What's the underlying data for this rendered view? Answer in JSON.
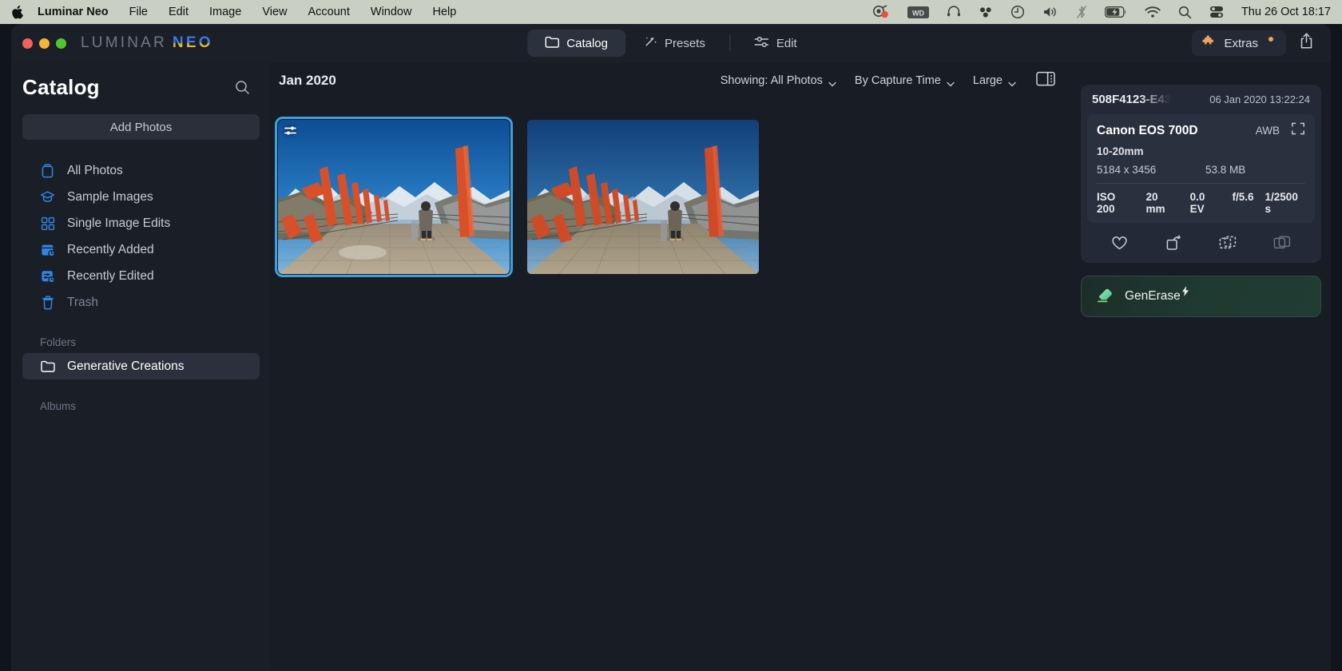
{
  "menubar": {
    "apple_icon": "apple-icon",
    "items": [
      {
        "label": "Luminar Neo",
        "bold": true
      },
      {
        "label": "File"
      },
      {
        "label": "Edit"
      },
      {
        "label": "Image"
      },
      {
        "label": "View"
      },
      {
        "label": "Account"
      },
      {
        "label": "Window"
      },
      {
        "label": "Help"
      }
    ],
    "tray_icons": [
      "screen-recording-icon",
      "wd-drive-icon",
      "headphones-icon",
      "dropbox-icon",
      "time-machine-icon",
      "volume-icon",
      "bluetooth-off-icon",
      "battery-charging-icon",
      "wifi-icon",
      "spotlight-search-icon",
      "control-center-icon"
    ],
    "clock": "Thu 26 Oct  18:17"
  },
  "app": {
    "brand_primary": "LUMINAR",
    "brand_secondary": "NEO",
    "traffic_lights": [
      "close",
      "minimize",
      "zoom"
    ],
    "tabs": [
      {
        "label": "Catalog",
        "icon": "folder-icon",
        "active": true
      },
      {
        "label": "Presets",
        "icon": "magic-wand-icon",
        "active": false
      },
      {
        "label": "Edit",
        "icon": "sliders-icon",
        "active": false
      }
    ],
    "extras_label": "Extras",
    "extras_icon": "puzzle-piece-icon",
    "extras_has_notification": true,
    "share_icon": "share-icon",
    "accent_orange": "#f0a261",
    "accent_blue": "#3e9fe0"
  },
  "sidebar": {
    "title": "Catalog",
    "search_icon": "search-icon",
    "add_photos_label": "Add Photos",
    "items": [
      {
        "label": "All Photos",
        "icon": "all-photos-icon",
        "state": "normal"
      },
      {
        "label": "Sample Images",
        "icon": "graduation-cap-icon",
        "state": "normal"
      },
      {
        "label": "Single Image Edits",
        "icon": "grid-squares-icon",
        "state": "normal"
      },
      {
        "label": "Recently Added",
        "icon": "calendar-clock-icon",
        "state": "normal"
      },
      {
        "label": "Recently Edited",
        "icon": "sliders-clock-icon",
        "state": "normal"
      },
      {
        "label": "Trash",
        "icon": "trash-icon",
        "state": "dim"
      }
    ],
    "sections": [
      {
        "label": "Folders",
        "items": [
          {
            "label": "Generative Creations",
            "icon": "folder-icon",
            "selected": true
          }
        ]
      },
      {
        "label": "Albums",
        "items": []
      }
    ]
  },
  "content": {
    "month_title": "Jan 2020",
    "showing_label": "Showing: All Photos",
    "sort_label": "By Capture Time",
    "size_label": "Large",
    "panel_toggle_icon": "right-panel-toggle-icon",
    "thumbnails": [
      {
        "name": "mountain-platform-edited",
        "selected": true,
        "has_edit_badge": true,
        "edit_badge_icon": "sliders-icon"
      },
      {
        "name": "mountain-platform-original",
        "selected": false,
        "has_edit_badge": false
      }
    ]
  },
  "info": {
    "filename": "508F4123-E43",
    "capture_date": "06 Jan 2020 13:22:24",
    "camera": "Canon EOS 700D",
    "white_balance": "AWB",
    "crop_icon": "crop-frame-icon",
    "lens": "10-20mm",
    "dimensions": "5184 x 3456",
    "filesize": "53.8 MB",
    "exif": [
      "ISO 200",
      "20 mm",
      "0.0 EV",
      "f/5.6",
      "1/2500 s"
    ],
    "actions": [
      {
        "name": "favorite-heart-icon",
        "dim": false
      },
      {
        "name": "rotate-icon",
        "dim": false
      },
      {
        "name": "duplicate-icon",
        "dim": false
      },
      {
        "name": "stack-icon",
        "dim": true
      }
    ],
    "generase_label": "GenErase",
    "generase_icon": "eraser-icon",
    "generase_bolt_icon": "lightning-bolt-icon"
  }
}
